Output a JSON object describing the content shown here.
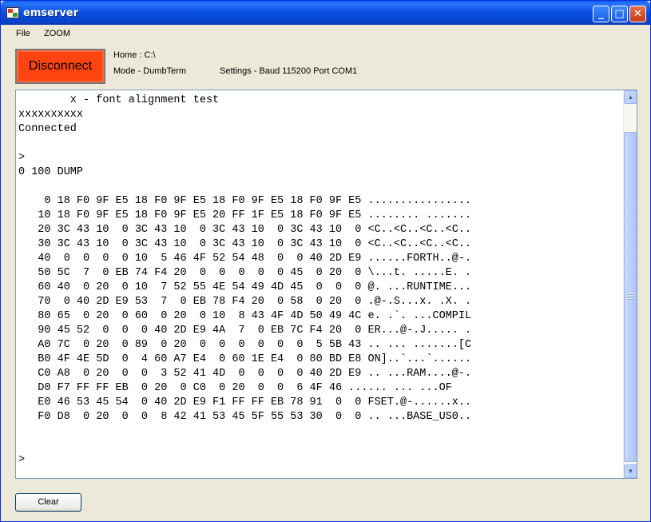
{
  "window": {
    "title": "emserver",
    "minimize": "_",
    "maximize": "□",
    "close": "✕"
  },
  "menu": {
    "file": "File",
    "zoom": "ZOOM"
  },
  "controls": {
    "disconnect_label": "Disconnect",
    "home": "Home :  C:\\",
    "mode": "Mode - DumbTerm",
    "settings": "Settings - Baud 115200 Port COM1",
    "clear_label": "Clear",
    "disconnect_color": "#ff4411"
  },
  "terminal": {
    "text": "        x - font alignment test\nxxxxxxxxxx\nConnected\n\n>\n0 100 DUMP\n\n    0 18 F0 9F E5 18 F0 9F E5 18 F0 9F E5 18 F0 9F E5 ................\n   10 18 F0 9F E5 18 F0 9F E5 20 FF 1F E5 18 F0 9F E5 ........ .......\n   20 3C 43 10  0 3C 43 10  0 3C 43 10  0 3C 43 10  0 <C..<C..<C..<C..\n   30 3C 43 10  0 3C 43 10  0 3C 43 10  0 3C 43 10  0 <C..<C..<C..<C..\n   40  0  0  0  0 10  5 46 4F 52 54 48  0  0 40 2D E9 ......FORTH..@-.\n   50 5C  7  0 EB 74 F4 20  0  0  0  0  0 45  0 20  0 \\...t. .....E. .\n   60 40  0 20  0 10  7 52 55 4E 54 49 4D 45  0  0  0 @. ...RUNTIME...\n   70  0 40 2D E9 53  7  0 EB 78 F4 20  0 58  0 20  0 .@-.S...x. .X. .\n   80 65  0 20  0 60  0 20  0 10  8 43 4F 4D 50 49 4C e. .`. ...COMPIL\n   90 45 52  0  0  0 40 2D E9 4A  7  0 EB 7C F4 20  0 ER...@-.J..... .\n   A0 7C  0 20  0 89  0 20  0  0  0  0  0  0  5 5B 43 .. ... .......[C\n   B0 4F 4E 5D  0  4 60 A7 E4  0 60 1E E4  0 80 BD E8 ON]..`...`......\n   C0 A8  0 20  0  0  3 52 41 4D  0  0  0  0 40 2D E9 .. ...RAM....@-.\n   D0 F7 FF FF EB  0 20  0 C0  0 20  0  0  6 4F 46 ...... ... ...OF\n   E0 46 53 45 54  0 40 2D E9 F1 FF FF EB 78 91  0  0 FSET.@-......x..\n   F0 D8  0 20  0  0  8 42 41 53 45 5F 55 53 30  0  0 .. ...BASE_US0..\n\n\n>"
  },
  "scrollbar": {
    "up": "▲",
    "down": "▼"
  }
}
